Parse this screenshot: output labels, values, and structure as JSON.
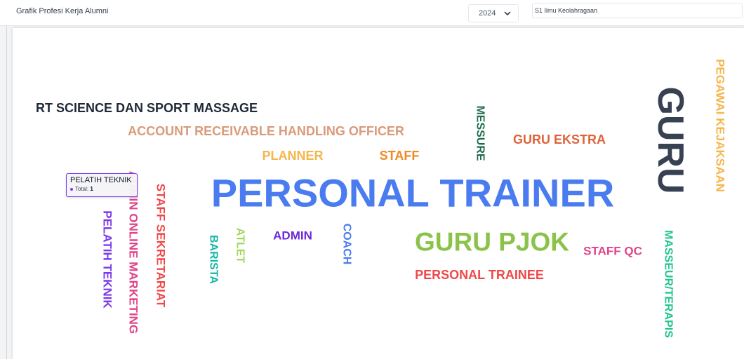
{
  "header": {
    "title": "Grafik Profesi Kerja Alumni",
    "year_select": {
      "selected": "2024"
    },
    "program_field": {
      "value": "S1 Ilmu Keolahragaan"
    }
  },
  "tooltip": {
    "title": "PELATIH TEKNIK",
    "total_label": "Total",
    "total_value": "1"
  },
  "word_cloud": [
    {
      "text": "PERSONAL TRAINER",
      "color": "#4a7cf0",
      "size": 56,
      "rotate": 0
    },
    {
      "text": "GURU",
      "color": "#374151",
      "size": 52,
      "rotate": 90
    },
    {
      "text": "GURU PJOK",
      "color": "#8bc34a",
      "size": 37,
      "rotate": 0
    },
    {
      "text": "RT SCIENCE DAN SPORT MASSAGE",
      "color": "#1f2937",
      "size": 18,
      "rotate": 0
    },
    {
      "text": "ACCOUNT RECEIVABLE HANDLING OFFICER",
      "color": "#d99a7a",
      "size": 18,
      "rotate": 0
    },
    {
      "text": "MESSURE",
      "color": "#1e6b4a",
      "size": 16,
      "rotate": 90
    },
    {
      "text": "GURU EKSTRA",
      "color": "#e0623a",
      "size": 18,
      "rotate": 0
    },
    {
      "text": "PLANNER",
      "color": "#f6b64c",
      "size": 18,
      "rotate": 0
    },
    {
      "text": "STAFF",
      "color": "#f08a24",
      "size": 18,
      "rotate": 0
    },
    {
      "text": "PEGAWAI KEJAKSAAN",
      "color": "#f6b64c",
      "size": 17,
      "rotate": 90
    },
    {
      "text": "ADMIN ONLINE MARKETING",
      "color": "#e0448a",
      "size": 17,
      "rotate": 90
    },
    {
      "text": "STAFF SEKRETARIAT",
      "color": "#f04848",
      "size": 17,
      "rotate": 90
    },
    {
      "text": "PELATIH TEKNIK",
      "color": "#7c3aed",
      "size": 17,
      "rotate": 90
    },
    {
      "text": "BARISTA",
      "color": "#14b8a6",
      "size": 16,
      "rotate": 90
    },
    {
      "text": "ATLET",
      "color": "#a3d65c",
      "size": 16,
      "rotate": 90
    },
    {
      "text": "ADMIN",
      "color": "#6d28d9",
      "size": 17,
      "rotate": 0
    },
    {
      "text": "COACH",
      "color": "#4a7cf0",
      "size": 16,
      "rotate": 90
    },
    {
      "text": "PERSONAL TRAINEE",
      "color": "#f04848",
      "size": 18,
      "rotate": 0
    },
    {
      "text": "STAFF QC",
      "color": "#e0448a",
      "size": 17,
      "rotate": 0
    },
    {
      "text": "MASSEUR/TERAPIS",
      "color": "#22c58b",
      "size": 16,
      "rotate": 90
    }
  ]
}
